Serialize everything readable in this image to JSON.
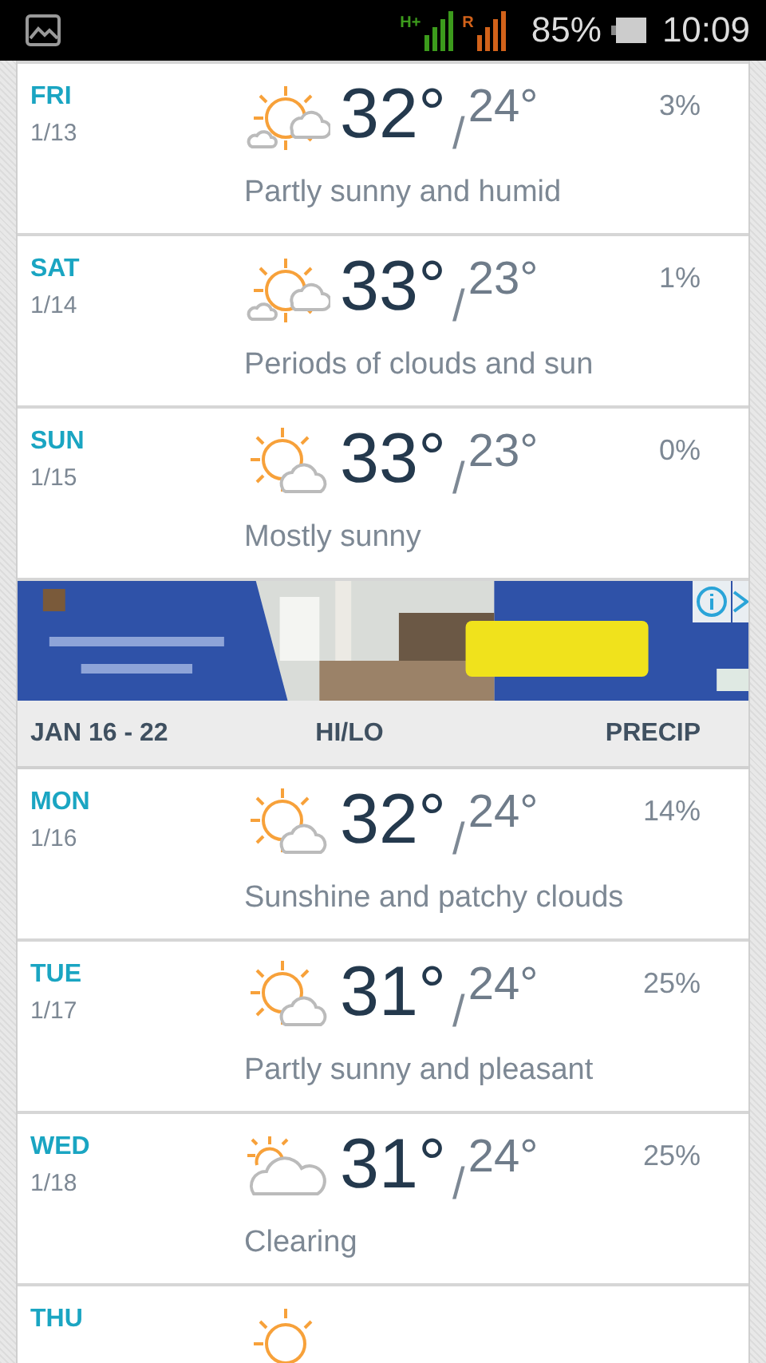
{
  "status_bar": {
    "battery": "85%",
    "time": "10:09",
    "network": "H+",
    "roaming": "R"
  },
  "days_before": [
    {
      "day": "FRI",
      "date": "1/13",
      "kind": "sun-clouds",
      "hi": "32°",
      "sep": "/",
      "lo": "24°",
      "precip": "3%",
      "summary": "Partly sunny and humid"
    },
    {
      "day": "SAT",
      "date": "1/14",
      "kind": "sun-clouds",
      "hi": "33°",
      "sep": "/",
      "lo": "23°",
      "precip": "1%",
      "summary": "Periods of clouds and sun"
    },
    {
      "day": "SUN",
      "date": "1/15",
      "kind": "sun-cloud",
      "hi": "33°",
      "sep": "/",
      "lo": "23°",
      "precip": "0%",
      "summary": "Mostly sunny"
    }
  ],
  "week_header": {
    "range": "JAN 16 - 22",
    "hilo": "HI/LO",
    "precip": "PRECIP"
  },
  "days_after": [
    {
      "day": "MON",
      "date": "1/16",
      "kind": "sun-cloud",
      "hi": "32°",
      "sep": "/",
      "lo": "24°",
      "precip": "14%",
      "summary": "Sunshine and patchy clouds"
    },
    {
      "day": "TUE",
      "date": "1/17",
      "kind": "sun-cloud",
      "hi": "31°",
      "sep": "/",
      "lo": "24°",
      "precip": "25%",
      "summary": "Partly sunny and pleasant"
    },
    {
      "day": "WED",
      "date": "1/18",
      "kind": "cloud-sun",
      "hi": "31°",
      "sep": "/",
      "lo": "24°",
      "precip": "25%",
      "summary": "Clearing"
    },
    {
      "day": "THU",
      "kind": "sun"
    }
  ]
}
